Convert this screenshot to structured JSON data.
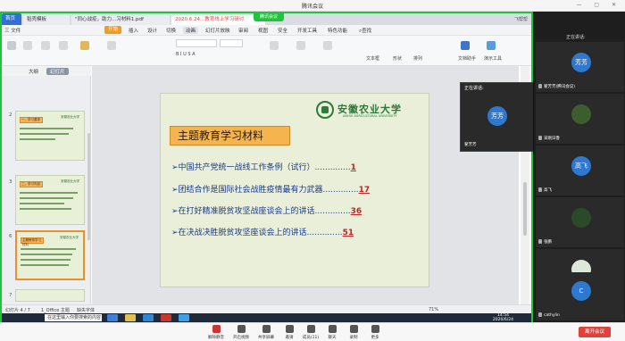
{
  "meeting": {
    "title": "腾讯会议",
    "share_label": "腾讯会议"
  },
  "wps": {
    "tabs": [
      "首页",
      "稻壳模板",
      "\"同心战疫，助力...习材料1.pdf",
      "2020.6.24...教育线上学习研讨"
    ],
    "right_info": "飞帮帮",
    "menu": [
      "三 文件",
      "开始",
      "插入",
      "设计",
      "切换",
      "动画",
      "幻灯片放映",
      "审阅",
      "视图",
      "安全",
      "开发工具",
      "特色功能",
      "查找"
    ],
    "ribbon_right": [
      "文本框",
      "形状",
      "排列",
      "文档助手",
      "演示工具"
    ]
  },
  "left_panel": {
    "tabs": [
      "大纲",
      "幻灯片"
    ],
    "slide_numbers": [
      "2",
      "3",
      "6",
      "7"
    ],
    "thumb_titles": [
      "一、学习要求",
      "二、学习内容",
      "主题教育学习材料",
      ""
    ]
  },
  "slide": {
    "logo_text": "安徽农业大学",
    "logo_sub": "ANHUI AGRICULTURAL UNIVERSITY",
    "title": "主题教育学习材料",
    "items": [
      {
        "text": "➢中国共产党统一战线工作条例（试行）",
        "dots": "..............",
        "page": "1"
      },
      {
        "text": "➢团结合作是国际社会战胜疫情最有力武器",
        "dots": "..............",
        "page": "17"
      },
      {
        "text": "➢在打好精准脱贫攻坚战座谈会上的讲话",
        "dots": "..............",
        "page": "36"
      },
      {
        "text": "➢在决战决胜脱贫攻坚座谈会上的讲话",
        "dots": "..............",
        "page": "51"
      }
    ]
  },
  "popup": {
    "header": "正在讲话:",
    "avatar": "芳芳",
    "name": "翟芳芳"
  },
  "status": {
    "slide_info": "幻灯片 4 / 7",
    "theme": "1_Office 主题",
    "font_missing": "缺失字体",
    "zoom": "71%"
  },
  "taskbar": {
    "search": "在这里输入你要搜索的内容",
    "ai": "搜索一下",
    "time": "14:54",
    "date": "2020/6/24"
  },
  "right_col": {
    "header": "正在讲话:",
    "tiles": [
      {
        "avatar": "芳芳",
        "name": "翟芳芳(腾讯会议)",
        "color": "#2e78d0"
      },
      {
        "avatar": "",
        "name": "宋刚日鲁",
        "color": "#3c5d2e"
      },
      {
        "avatar": "高飞",
        "name": "高飞",
        "color": "#2e78d0"
      },
      {
        "avatar": "",
        "name": "张鹏",
        "color": "#2b4a2a"
      },
      {
        "avatar": "",
        "name": "王宇飞",
        "color": "#dfe6da"
      },
      {
        "avatar": "C",
        "name": "cathylin",
        "color": "#2e78d0"
      }
    ]
  },
  "bottom_bar": {
    "buttons": [
      "解除静音",
      "开启视频",
      "共享屏幕",
      "邀请",
      "成员(11)",
      "聊天",
      "录制",
      "更多"
    ],
    "leave": "离开会议"
  }
}
